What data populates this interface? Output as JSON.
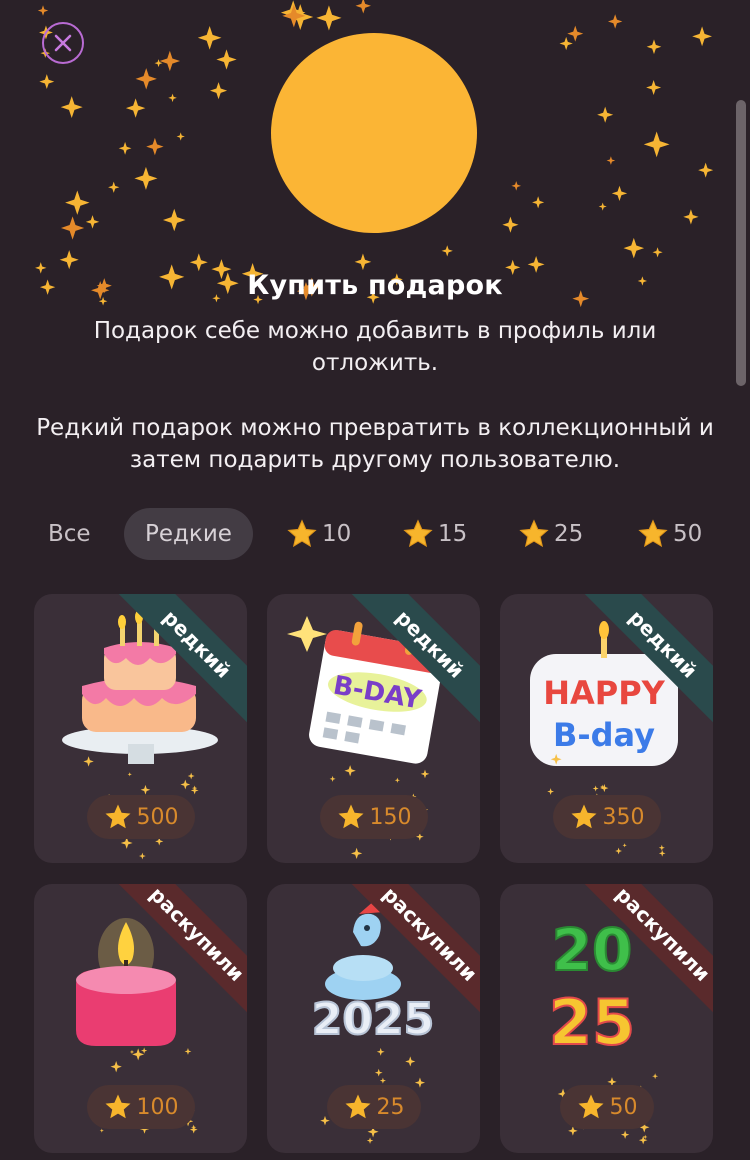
{
  "header": {
    "close_icon": "close-icon",
    "title": "Купить подарок",
    "description_1": "Подарок себе можно добавить в профиль или отложить.",
    "description_2": "Редкий подарок можно превратить в коллекционный и затем подарить другому пользователю."
  },
  "filters": [
    {
      "label": "Все",
      "icon": null
    },
    {
      "label": "Редкие",
      "icon": null,
      "active": true
    },
    {
      "label": "10",
      "icon": "star-icon"
    },
    {
      "label": "15",
      "icon": "star-icon"
    },
    {
      "label": "25",
      "icon": "star-icon"
    },
    {
      "label": "50",
      "icon": "star-icon"
    }
  ],
  "gifts": [
    {
      "name": "birthday-cake",
      "badge": "редкий",
      "badge_type": "rare",
      "price": "500"
    },
    {
      "name": "b-day-calendar",
      "badge": "редкий",
      "badge_type": "rare",
      "price": "150",
      "art_text": "B-DAY"
    },
    {
      "name": "happy-bday-sign",
      "badge": "редкий",
      "badge_type": "rare",
      "price": "350",
      "art_text_1": "HAPPY",
      "art_text_2": "B-day"
    },
    {
      "name": "candle",
      "badge": "раскупили",
      "badge_type": "sold",
      "price": "100"
    },
    {
      "name": "snake-2025",
      "badge": "раскупили",
      "badge_type": "sold",
      "price": "25",
      "art_text": "2025"
    },
    {
      "name": "numbers-2025",
      "badge": "раскупили",
      "badge_type": "sold",
      "price": "50",
      "art_text_1": "20",
      "art_text_2": "25"
    }
  ],
  "colors": {
    "background": "#2a2128",
    "card": "#3a2f38",
    "accent_gold": "#fbb535",
    "rare_ribbon": "#2a4a4c",
    "sold_ribbon": "#5a2a2c",
    "price_text": "#d88a2c"
  }
}
